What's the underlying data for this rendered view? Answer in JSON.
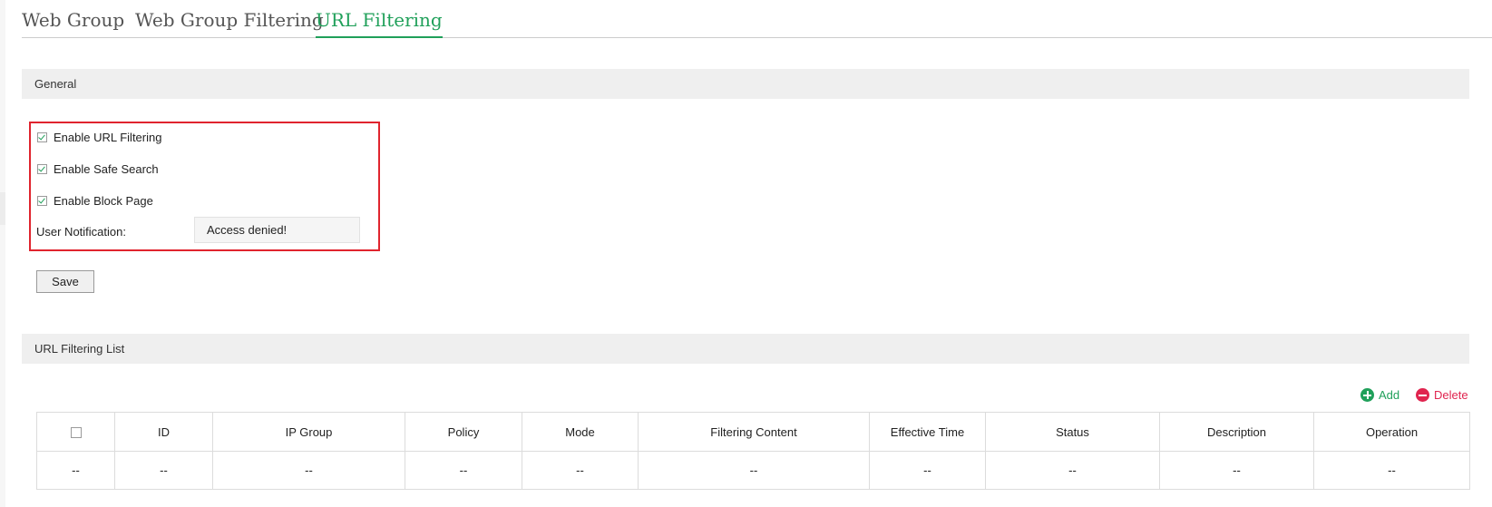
{
  "tabs": [
    {
      "label": "Web Group"
    },
    {
      "label": "Web Group Filtering"
    },
    {
      "label": "URL Filtering"
    }
  ],
  "active_tab": "URL Filtering",
  "general": {
    "title": "General",
    "enable_url_filtering": {
      "label": "Enable URL Filtering",
      "checked": true
    },
    "enable_safe_search": {
      "label": "Enable Safe Search",
      "checked": true
    },
    "enable_block_page": {
      "label": "Enable Block Page",
      "checked": true
    },
    "user_notification": {
      "label": "User Notification:",
      "value": "Access denied!"
    },
    "save_label": "Save"
  },
  "list": {
    "title": "URL Filtering List",
    "add_label": "Add",
    "delete_label": "Delete",
    "columns": [
      "ID",
      "IP Group",
      "Policy",
      "Mode",
      "Filtering Content",
      "Effective Time",
      "Status",
      "Description",
      "Operation"
    ],
    "rows": [
      [
        "--",
        "--",
        "--",
        "--",
        "--",
        "--",
        "--",
        "--",
        "--",
        "--"
      ]
    ]
  },
  "colors": {
    "accent": "#20a05a",
    "highlight": "#e0242e",
    "delete": "#e0244f"
  }
}
